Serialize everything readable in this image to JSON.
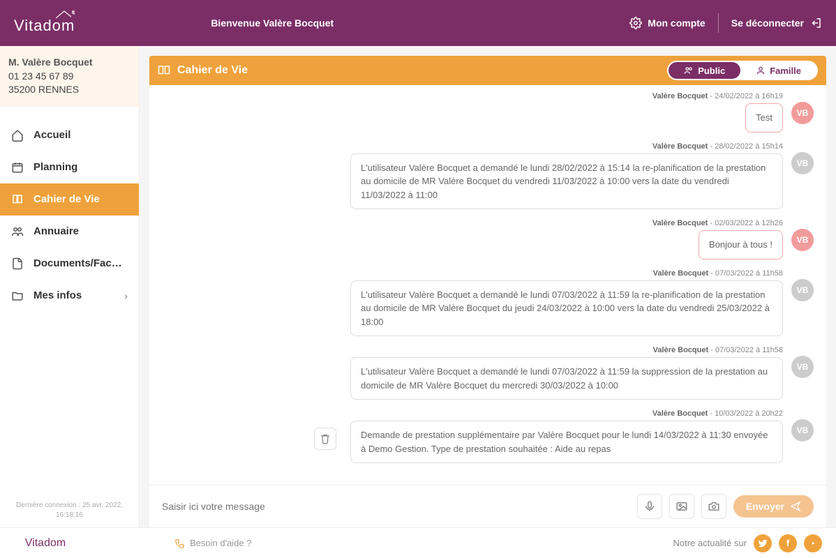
{
  "header": {
    "logo": "Vitadom",
    "welcome": "Bienvenue Valère Bocquet",
    "account": "Mon compte",
    "logout": "Se déconnecter"
  },
  "profile": {
    "name": "M. Valère Bocquet",
    "phone": "01 23 45 67 89",
    "city": "35200 RENNES"
  },
  "nav": {
    "items": [
      {
        "label": "Accueil"
      },
      {
        "label": "Planning"
      },
      {
        "label": "Cahier de Vie"
      },
      {
        "label": "Annuaire"
      },
      {
        "label": "Documents/Fac…"
      },
      {
        "label": "Mes infos"
      }
    ],
    "last_connection": "Dernière connexion : 25 avr. 2022, 16:18:16"
  },
  "panel": {
    "title": "Cahier de Vie",
    "toggle_public": "Public",
    "toggle_famille": "Famille"
  },
  "messages": [
    {
      "author": "Valère Bocquet",
      "ts": "24/02/2022 à 16h19",
      "text": "Test",
      "pink": true,
      "avatar_pink": true
    },
    {
      "author": "Valère Bocquet",
      "ts": "28/02/2022 à 15h14",
      "text": "L'utilisateur Valère Bocquet a demandé le lundi 28/02/2022 à 15:14 la re-planification de la prestation au domicile de MR Valère Bocquet du vendredi 11/03/2022 à 10:00 vers la date du vendredi 11/03/2022 à 11:00",
      "pink": false,
      "avatar_pink": false
    },
    {
      "author": "Valère Bocquet",
      "ts": "02/03/2022 à 12h26",
      "text": "Bonjour à tous !",
      "pink": true,
      "avatar_pink": true
    },
    {
      "author": "Valère Bocquet",
      "ts": "07/03/2022 à 11h58",
      "text": "L'utilisateur Valère Bocquet a demandé le lundi 07/03/2022 à 11:59 la re-planification de la prestation au domicile de MR Valère Bocquet du jeudi 24/03/2022 à 10:00 vers la date du vendredi 25/03/2022 à 18:00",
      "pink": false,
      "avatar_pink": false
    },
    {
      "author": "Valère Bocquet",
      "ts": "07/03/2022 à 11h58",
      "text": "L'utilisateur Valère Bocquet a demandé le lundi 07/03/2022 à 11:59 la suppression de la prestation au domicile de MR Valère Bocquet du mercredi 30/03/2022 à 10:00",
      "pink": false,
      "avatar_pink": false
    },
    {
      "author": "Valère Bocquet",
      "ts": "10/03/2022 à 20h22",
      "text": "Demande de prestation supplémentaire par Valère Bocquet pour le lundi 14/03/2022 à 11:30 envoyée à Demo Gestion. Type de prestation souhaitée : Aide au repas",
      "pink": false,
      "avatar_pink": false,
      "trash": true
    }
  ],
  "avatar_initials": "VB",
  "composer": {
    "placeholder": "Saisir ici votre message",
    "send": "Envoyer"
  },
  "footer": {
    "logo": "Vitadom",
    "help": "Besoin d'aide ?",
    "actu": "Notre actualité sur"
  }
}
